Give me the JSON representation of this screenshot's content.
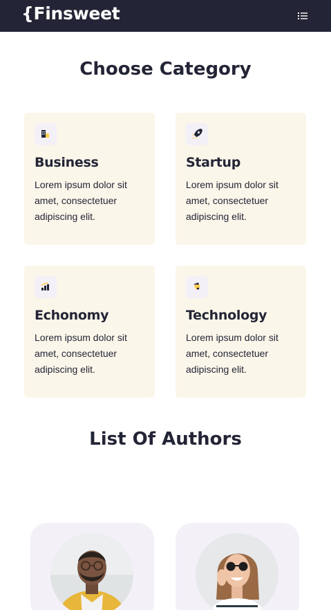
{
  "brand": {
    "logo_text": "{Finsweet"
  },
  "nav": {
    "menu_icon": "hamburger-list-icon"
  },
  "categories_section": {
    "title": "Choose Category",
    "items": [
      {
        "title": "Business",
        "description": "Lorem ipsum dolor sit amet, consectetuer adipiscing elit.",
        "icon": "business-building-icon"
      },
      {
        "title": "Startup",
        "description": "Lorem ipsum dolor sit amet, consectetuer adipiscing elit.",
        "icon": "rocket-icon"
      },
      {
        "title": "Echonomy",
        "description": "Lorem ipsum dolor sit amet, consectetuer adipiscing elit.",
        "icon": "bar-chart-icon"
      },
      {
        "title": "Technology",
        "description": "Lorem ipsum dolor sit amet, consectetuer adipiscing elit.",
        "icon": "chip-icon"
      }
    ]
  },
  "authors_section": {
    "title": "List Of Authors",
    "authors": [
      {
        "avatar": "author-avatar-man-glasses"
      },
      {
        "avatar": "author-avatar-woman-sunglasses"
      }
    ]
  },
  "colors": {
    "navbar_bg": "#232536",
    "card_bg": "#fbf6ea",
    "icon_bg": "#f4f0f8",
    "accent_yellow": "#ffd050",
    "text": "#232536"
  }
}
